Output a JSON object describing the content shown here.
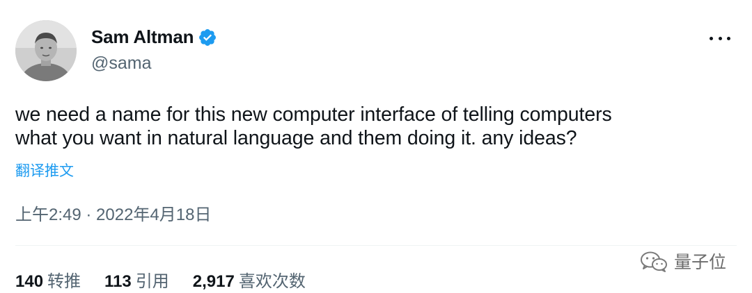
{
  "author": {
    "name": "Sam Altman",
    "handle": "@sama",
    "verified": true,
    "verified_color": "#1d9bf0"
  },
  "tweet": {
    "text": "we need a name for this new computer interface of telling computers\nwhat you want in natural language and them doing it. any ideas?",
    "translate_label": "翻译推文",
    "timestamp": "上午2:49 · 2022年4月18日"
  },
  "stats": {
    "retweets": {
      "count": "140",
      "label": "转推"
    },
    "quotes": {
      "count": "113",
      "label": "引用"
    },
    "likes": {
      "count": "2,917",
      "label": "喜欢次数"
    }
  },
  "watermark": {
    "text": "量子位"
  },
  "icons": {
    "more": "more-horizontal-icon",
    "verified": "verified-badge-icon",
    "watermark": "wechat-icon"
  }
}
